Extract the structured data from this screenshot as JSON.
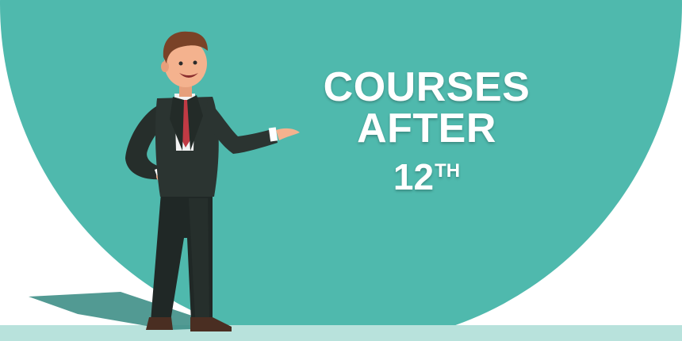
{
  "banner": {
    "heading_line1": "COURSES AFTER",
    "heading_number": "12",
    "heading_suffix": "TH"
  },
  "colors": {
    "background_circle": "#4fb9ad",
    "floor": "#b8e2dc",
    "heading_text": "#ffffff",
    "suit": "#2b3431",
    "tie": "#c13a44",
    "skin": "#f4b28e",
    "hair": "#7a4227"
  },
  "illustration": {
    "icon": "businessman-presenting-illustration"
  }
}
